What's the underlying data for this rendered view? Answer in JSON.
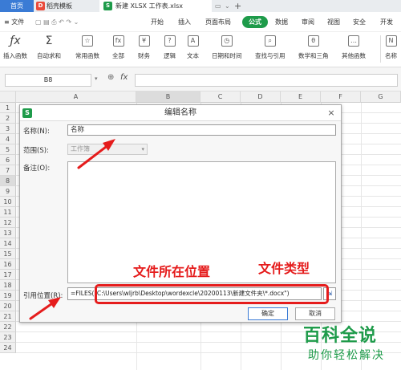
{
  "tabs": {
    "home": "首页",
    "template": "稻壳模板",
    "file": "新建 XLSX 工作表.xlsx",
    "plus": "+"
  },
  "menu": {
    "file": "≡ 文件",
    "items": [
      "开始",
      "插入",
      "页面布局",
      "公式",
      "数据",
      "审阅",
      "视图",
      "安全",
      "开发"
    ],
    "active": "公式"
  },
  "ribbon": {
    "insert_function": "插入函数",
    "autosum": "自动求和",
    "common": "常用函数",
    "all": "全部",
    "finance": "财务",
    "logic": "逻辑",
    "text": "文本",
    "datetime": "日期和时间",
    "lookup": "查找与引用",
    "math": "数学和三角",
    "other": "其他函数",
    "name_manager": "名称"
  },
  "formula_bar": {
    "cell_ref": "B8",
    "fx": "fx"
  },
  "columns": [
    "A",
    "B",
    "C",
    "D",
    "E",
    "F",
    "G"
  ],
  "rows": [
    "1",
    "2",
    "3",
    "4",
    "5",
    "6",
    "7",
    "8",
    "9",
    "10",
    "11",
    "12",
    "13",
    "14",
    "15",
    "16",
    "17",
    "18",
    "19",
    "20",
    "21",
    "22",
    "23",
    "24"
  ],
  "dialog": {
    "title": "编辑名称",
    "logo": "S",
    "close": "×",
    "name_label": "名称(N):",
    "name_value": "名称",
    "scope_label": "范围(S):",
    "scope_value": "工作簿",
    "comment_label": "备注(O):",
    "ref_label": "引用位置(R):",
    "ref_value": "=FILES(\"C:\\Users\\wljrb\\Desktop\\wordexcle\\20200113\\新建文件夹\\*.docx\")",
    "ok": "确定",
    "cancel": "取消"
  },
  "annotations": {
    "location": "文件所在位置",
    "type": "文件类型",
    "color": "#e51c1c"
  },
  "watermark": {
    "title": "百科全说",
    "subtitle": "助你轻松解决"
  },
  "colors": {
    "accent": "#1e9b4a",
    "home_tab": "#3a7bd5"
  }
}
